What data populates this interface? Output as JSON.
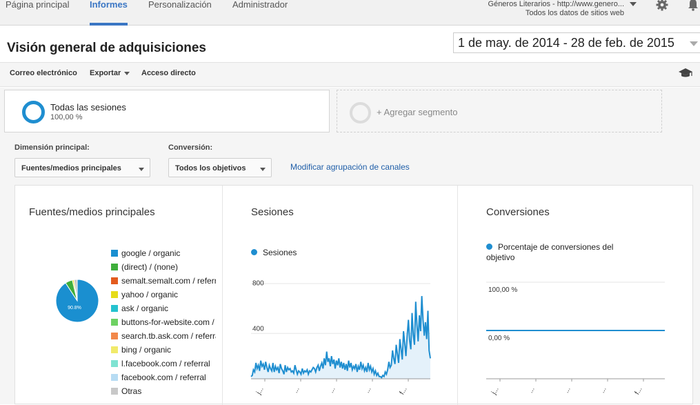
{
  "nav": {
    "tabs": [
      {
        "label": "Página principal"
      },
      {
        "label": "Informes"
      },
      {
        "label": "Personalización"
      },
      {
        "label": "Administrador"
      }
    ],
    "account_line1": "Géneros Literarios - http://www.genero...",
    "account_line2": "Todos los datos de sitios web"
  },
  "header": {
    "title": "Visión general de adquisiciones",
    "date_range": "1 de may. de 2014 - 28 de feb. de 2015"
  },
  "toolbar": {
    "email_label": "Correo electrónico",
    "export_label": "Exportar",
    "shortcut_label": "Acceso directo"
  },
  "segments": {
    "active": {
      "name": "Todas las sesiones",
      "percent": "100,00 %",
      "color": "#1f8ed0"
    },
    "add_label": "+ Agregar segmento"
  },
  "dimensions": {
    "primary_label": "Dimensión principal:",
    "primary_value": "Fuentes/medios principales",
    "conversion_label": "Conversión:",
    "conversion_value": "Todos los objetivos",
    "modify_link": "Modificar agrupación de canales"
  },
  "panels": {
    "sources": {
      "title": "Fuentes/medios principales",
      "legend": [
        {
          "label": "google / organic",
          "color": "#1a8fd0"
        },
        {
          "label": "(direct) / (none)",
          "color": "#3fae3c"
        },
        {
          "label": "semalt.semalt.com / referral",
          "color": "#e35b1e"
        },
        {
          "label": "yahoo / organic",
          "color": "#e6dc1a"
        },
        {
          "label": "ask / organic",
          "color": "#25c2cf"
        },
        {
          "label": "buttons-for-website.com / referral",
          "color": "#6ed163"
        },
        {
          "label": "search.tb.ask.com / referral",
          "color": "#f2884a"
        },
        {
          "label": "bing / organic",
          "color": "#f1ea6a"
        },
        {
          "label": "l.facebook.com / referral",
          "color": "#7fe3d2"
        },
        {
          "label": "facebook.com / referral",
          "color": "#b7dcf3"
        },
        {
          "label": "Otras",
          "color": "#c8c8c8"
        }
      ]
    },
    "sessions": {
      "title": "Sesiones",
      "legend": "Sesiones"
    },
    "conversions": {
      "title": "Conversiones",
      "legend": "Porcentaje de conversiones del objetivo"
    }
  },
  "chart_data": [
    {
      "type": "pie",
      "labels": [
        "google / organic",
        "(direct) / (none)",
        "yahoo / organic",
        "Otras"
      ],
      "values": [
        90.8,
        5.5,
        1.2,
        2.5
      ],
      "slice_label": "90.8%"
    },
    {
      "type": "line",
      "series": [
        {
          "name": "Sesiones",
          "values": [
            20,
            30,
            80,
            60,
            140,
            90,
            120,
            70,
            160,
            110,
            130,
            80,
            150,
            100,
            60,
            120,
            90,
            70,
            140,
            60,
            110,
            80,
            100,
            50,
            130,
            90,
            70,
            40,
            120,
            60,
            100,
            80,
            90,
            60,
            70,
            50,
            120,
            80,
            40,
            70,
            60,
            40,
            90,
            50,
            70,
            60,
            80,
            40,
            70,
            60,
            80,
            100,
            90,
            60,
            100,
            120,
            70,
            110,
            140,
            90,
            180,
            120,
            240,
            150,
            180,
            110,
            200,
            130,
            170,
            90,
            160,
            120,
            180,
            100,
            150,
            90,
            140,
            80,
            130,
            70,
            160,
            100,
            140,
            80,
            110,
            90,
            130,
            60,
            110,
            80,
            150,
            90,
            120,
            70,
            100,
            60,
            140,
            80,
            110,
            60,
            90,
            40,
            70,
            30,
            50,
            20,
            20,
            10,
            30,
            20,
            60,
            40,
            80,
            150,
            100,
            120,
            250,
            180,
            130,
            300,
            220,
            140,
            350,
            260,
            170,
            420,
            310,
            200,
            380,
            520,
            340,
            260,
            580,
            390,
            300,
            680,
            480,
            330,
            560,
            420,
            730,
            520,
            380,
            500,
            350,
            600,
            250,
            180
          ]
        }
      ],
      "ylim": [
        0,
        840
      ],
      "y_ticks": [
        "400",
        "800"
      ],
      "x_ticks": [
        "j...",
        "...",
        "...",
        "...",
        "f..."
      ]
    },
    {
      "type": "line",
      "series": [
        {
          "name": "Porcentaje de conversiones del objetivo",
          "values": [
            0,
            0,
            0,
            0,
            0,
            0,
            0,
            0,
            0,
            0
          ]
        }
      ],
      "y_ticks": [
        "0,00 %",
        "100,00 %"
      ],
      "x_ticks": [
        "j...",
        "...",
        "...",
        "...",
        "f..."
      ]
    }
  ]
}
